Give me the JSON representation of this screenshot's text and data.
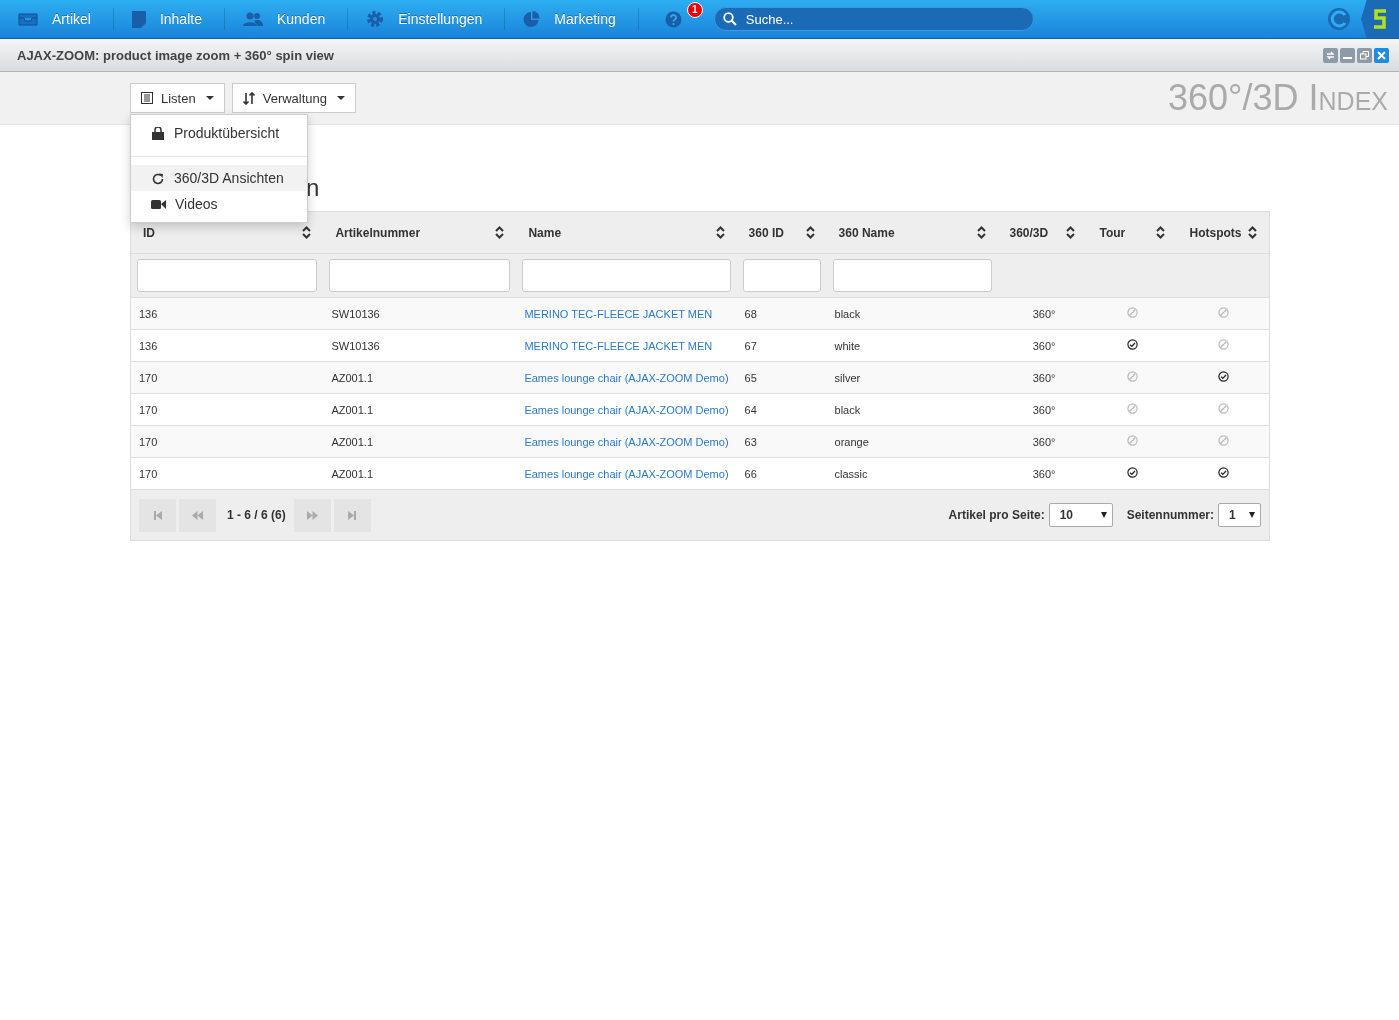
{
  "nav": {
    "items": [
      {
        "label": "Artikel"
      },
      {
        "label": "Inhalte"
      },
      {
        "label": "Kunden"
      },
      {
        "label": "Einstellungen"
      },
      {
        "label": "Marketing"
      }
    ],
    "notification_count": "1",
    "search": {
      "placeholder": "Suche..."
    }
  },
  "window": {
    "title": "AJAX-ZOOM: product image zoom + 360° spin view"
  },
  "toolbar": {
    "buttons": [
      {
        "label": "Listen"
      },
      {
        "label": "Verwaltung"
      }
    ],
    "brand_title": "360°/3D Index"
  },
  "dropdown": {
    "items": [
      {
        "label": "Produktübersicht",
        "selected": false
      },
      {
        "label": "360/3D Ansichten",
        "selected": true
      },
      {
        "label": "Videos",
        "selected": false
      }
    ]
  },
  "heading": "n",
  "table": {
    "columns": [
      {
        "label": "ID"
      },
      {
        "label": "Artikelnummer"
      },
      {
        "label": "Name"
      },
      {
        "label": "360 ID"
      },
      {
        "label": "360 Name"
      },
      {
        "label": "360/3D"
      },
      {
        "label": "Tour"
      },
      {
        "label": "Hotspots"
      }
    ],
    "rows": [
      {
        "id": "136",
        "article": "SW10136",
        "name": "MERINO TEC-FLEECE JACKET MEN",
        "spin_id": "68",
        "spin_name": "black",
        "type": "360°",
        "tour": false,
        "hotspots": false
      },
      {
        "id": "136",
        "article": "SW10136",
        "name": "MERINO TEC-FLEECE JACKET MEN",
        "spin_id": "67",
        "spin_name": "white",
        "type": "360°",
        "tour": true,
        "hotspots": false
      },
      {
        "id": "170",
        "article": "AZ001.1",
        "name": "Eames lounge chair (AJAX-ZOOM Demo)",
        "spin_id": "65",
        "spin_name": "silver",
        "type": "360°",
        "tour": false,
        "hotspots": true
      },
      {
        "id": "170",
        "article": "AZ001.1",
        "name": "Eames lounge chair (AJAX-ZOOM Demo)",
        "spin_id": "64",
        "spin_name": "black",
        "type": "360°",
        "tour": false,
        "hotspots": false
      },
      {
        "id": "170",
        "article": "AZ001.1",
        "name": "Eames lounge chair (AJAX-ZOOM Demo)",
        "spin_id": "63",
        "spin_name": "orange",
        "type": "360°",
        "tour": false,
        "hotspots": false
      },
      {
        "id": "170",
        "article": "AZ001.1",
        "name": "Eames lounge chair (AJAX-ZOOM Demo)",
        "spin_id": "66",
        "spin_name": "classic",
        "type": "360°",
        "tour": true,
        "hotspots": true
      }
    ]
  },
  "pager": {
    "range": "1 - 6 / 6 (6)",
    "per_page_label": "Artikel pro Seite:",
    "per_page": "10",
    "page_label": "Seitennummer:",
    "page": "1"
  }
}
